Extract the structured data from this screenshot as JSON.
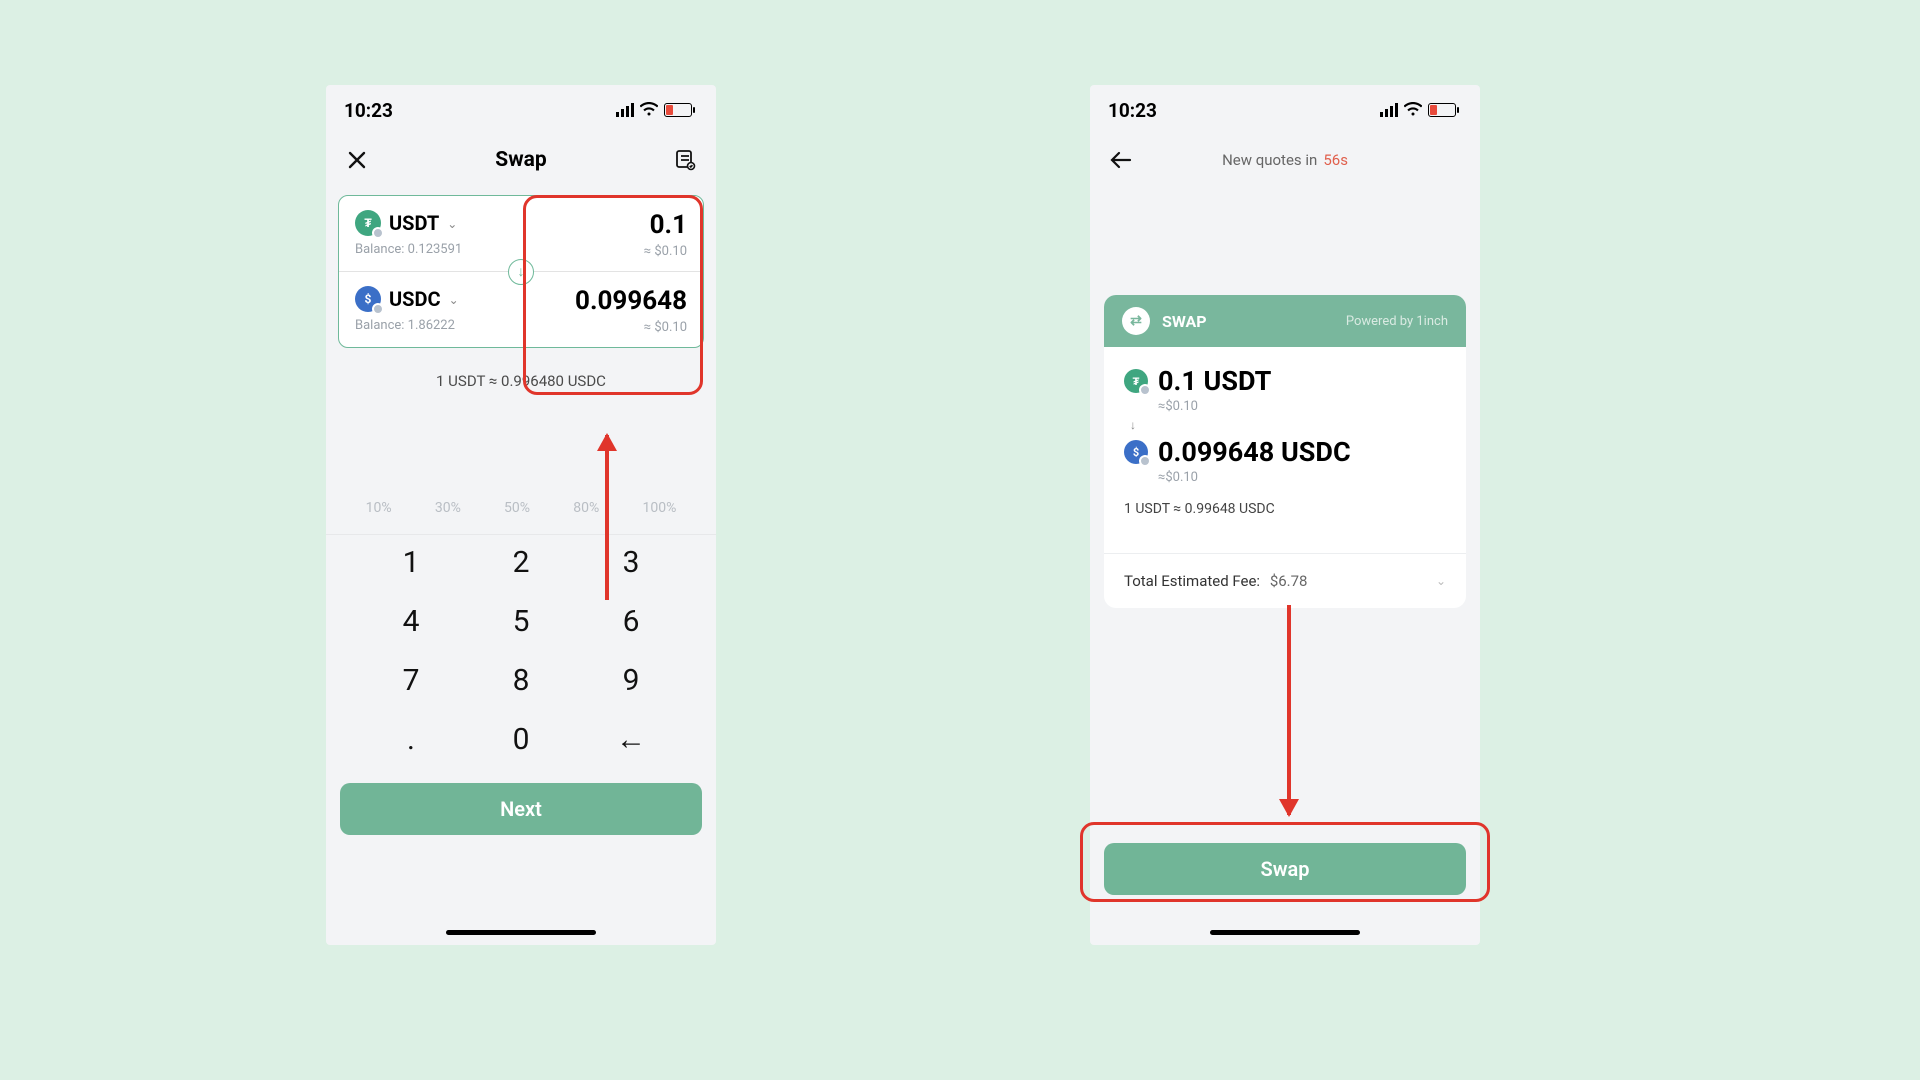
{
  "status": {
    "time": "10:23"
  },
  "left": {
    "title": "Swap",
    "from": {
      "token": "USDT",
      "balance_label": "Balance: 0.123591",
      "amount": "0.1",
      "approx": "≈ $0.10"
    },
    "to": {
      "token": "USDC",
      "balance_label": "Balance: 1.86222",
      "amount": "0.099648",
      "approx": "≈ $0.10"
    },
    "rate": "1 USDT ≈ 0.996480 USDC",
    "percents": [
      "10%",
      "30%",
      "50%",
      "80%",
      "100%"
    ],
    "keys": [
      "1",
      "2",
      "3",
      "4",
      "5",
      "6",
      "7",
      "8",
      "9",
      ".",
      "0",
      "←"
    ],
    "next": "Next"
  },
  "right": {
    "quotes_prefix": "New quotes in",
    "quotes_time": "56s",
    "head_label": "SWAP",
    "powered": "Powered by 1inch",
    "from_line": "0.1 USDT",
    "from_sub": "≈$0.10",
    "to_line": "0.099648 USDC",
    "to_sub": "≈$0.10",
    "rate": "1 USDT ≈ 0.99648 USDC",
    "fee_label": "Total Estimated Fee:",
    "fee_value": "$6.78",
    "swap": "Swap"
  }
}
